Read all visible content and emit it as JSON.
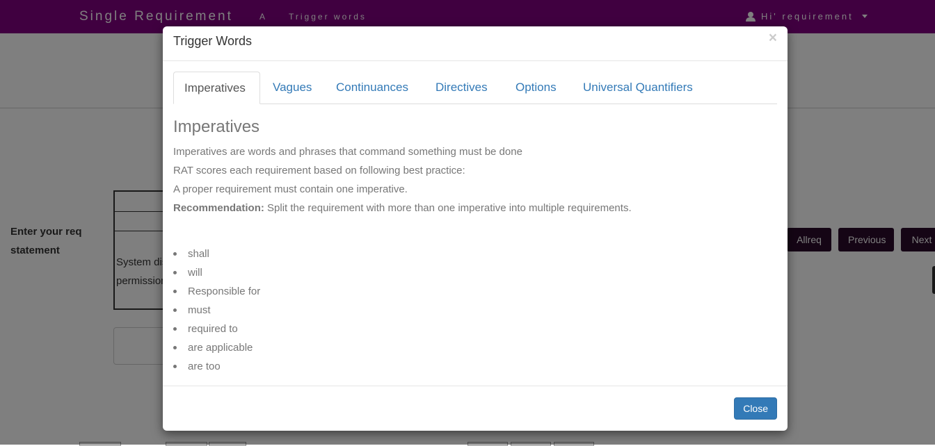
{
  "navbar": {
    "brand": "Single Requirement",
    "link_a": "A",
    "link_trigger": "Trigger words",
    "user_menu": "Hi' requirement",
    "color": "#800080"
  },
  "page": {
    "req_label": "Enter your req statement",
    "req_text_line1": "System dis",
    "req_text_line2": "permission",
    "buttons": {
      "allreq": "Allreq",
      "previous": "Previous",
      "next": "Next"
    }
  },
  "modal": {
    "title": "Trigger Words",
    "close_x": "×",
    "tabs": [
      {
        "label": "Imperatives",
        "active": true
      },
      {
        "label": "Vagues",
        "active": false
      },
      {
        "label": "Continuances",
        "active": false
      },
      {
        "label": "Directives",
        "active": false
      },
      {
        "label": "Options",
        "active": false
      },
      {
        "label": "Universal Quantifiers",
        "active": false
      }
    ],
    "section_heading": "Imperatives",
    "description": [
      "Imperatives are words and phrases that command something must be done",
      "RAT scores each requirement based on following best practice:",
      "A proper requirement must contain one imperative."
    ],
    "recommendation_label": "Recommendation:",
    "recommendation_text": " Split the requirement with more than one imperative into multiple requirements.",
    "words": [
      "shall",
      "will",
      "Responsible for",
      "must",
      "required to",
      "are applicable",
      "are too"
    ],
    "close_button": "Close",
    "link_color": "#337ab7",
    "button_color": "#337ab7"
  }
}
